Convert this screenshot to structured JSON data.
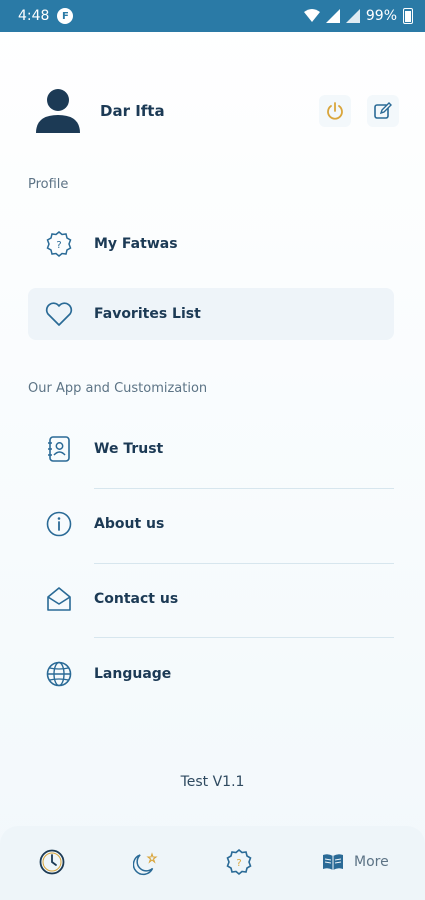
{
  "status_bar": {
    "time": "4:48",
    "app_badge": "F",
    "battery": "99%"
  },
  "profile": {
    "name": "Dar Ifta",
    "icons": {
      "avatar": "user-avatar-icon",
      "logout": "power-icon",
      "edit": "edit-icon"
    }
  },
  "sections": {
    "profile_label": "Profile",
    "app_label": "Our App and Customization"
  },
  "menu": {
    "my_fatwas": "My Fatwas",
    "favorites": "Favorites List",
    "we_trust": "We Trust",
    "about_us": "About us",
    "contact_us": "Contact us",
    "language": "Language"
  },
  "version": "Test V1.1",
  "bottom_nav": {
    "more_label": "More",
    "icons": [
      "clock-icon",
      "moon-star-icon",
      "question-badge-icon",
      "book-icon"
    ]
  },
  "colors": {
    "status_bar": "#2a7aa6",
    "text_primary": "#1c3a55",
    "accent_gold": "#d9a53b",
    "icon_blue": "#2a6a96"
  }
}
